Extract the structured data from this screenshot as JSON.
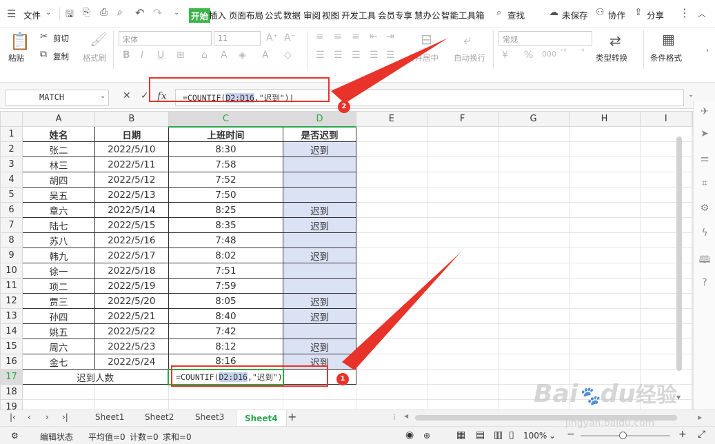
{
  "menubar": {
    "file": "文件",
    "tabs": [
      "开始",
      "插入",
      "页面布局",
      "公式",
      "数据",
      "审阅",
      "视图",
      "开发工具",
      "会员专享",
      "慧办公",
      "智能工具箱"
    ],
    "search": "查找",
    "unsaved": "未保存",
    "collab": "协作",
    "share": "分享"
  },
  "ribbon": {
    "paste": "粘贴",
    "cut": "剪切",
    "copy": "复制",
    "format_painter": "格式刷",
    "font_name": "宋体",
    "font_size": "11",
    "merge_center": "合并居中",
    "wrap": "自动换行",
    "number_format": "常规",
    "type_convert": "类型转换",
    "cond_format": "条件格式"
  },
  "formula_bar": {
    "name_box": "MATCH",
    "fx": "fx",
    "formula_prefix": "=COUNTIF(",
    "formula_ref": "D2:D16",
    "formula_suffix": ",\"迟到\")|"
  },
  "grid": {
    "columns": [
      "A",
      "B",
      "C",
      "D",
      "E",
      "F",
      "G",
      "H",
      "I"
    ],
    "header_row": [
      "姓名",
      "日期",
      "上班时间",
      "是否迟到"
    ],
    "rows": [
      [
        "张二",
        "2022/5/10",
        "8:30",
        "迟到"
      ],
      [
        "林三",
        "2022/5/11",
        "7:58",
        ""
      ],
      [
        "胡四",
        "2022/5/12",
        "7:52",
        ""
      ],
      [
        "吴五",
        "2022/5/13",
        "7:50",
        ""
      ],
      [
        "章六",
        "2022/5/14",
        "8:25",
        "迟到"
      ],
      [
        "陆七",
        "2022/5/15",
        "8:35",
        "迟到"
      ],
      [
        "苏八",
        "2022/5/16",
        "7:48",
        ""
      ],
      [
        "韩九",
        "2022/5/17",
        "8:02",
        "迟到"
      ],
      [
        "徐一",
        "2022/5/18",
        "7:51",
        ""
      ],
      [
        "项二",
        "2022/5/19",
        "7:59",
        ""
      ],
      [
        "贾三",
        "2022/5/20",
        "8:05",
        "迟到"
      ],
      [
        "孙四",
        "2022/5/21",
        "8:40",
        "迟到"
      ],
      [
        "姚五",
        "2022/5/22",
        "7:42",
        ""
      ],
      [
        "周六",
        "2022/5/23",
        "8:12",
        "迟到"
      ],
      [
        "金七",
        "2022/5/24",
        "8:16",
        "迟到"
      ]
    ],
    "row17_label": "迟到人数",
    "row17_formula_prefix": "=COUNTIF(",
    "row17_formula_ref": "D2:D16",
    "row17_formula_suffix": ",\"迟到\")",
    "row_numbers": [
      "1",
      "2",
      "3",
      "4",
      "5",
      "6",
      "7",
      "8",
      "9",
      "10",
      "11",
      "12",
      "13",
      "14",
      "15",
      "16",
      "17",
      "18",
      "19"
    ]
  },
  "annotations": {
    "badge1": "1",
    "badge2": "2",
    "color": "#e8332a"
  },
  "sheet_tabs": [
    "Sheet1",
    "Sheet2",
    "Sheet3",
    "Sheet4"
  ],
  "active_sheet": "Sheet4",
  "statusbar": {
    "mode": "编辑状态",
    "average": "平均值=0",
    "count": "计数=0",
    "sum": "求和=0",
    "zoom": "100%"
  },
  "watermark": {
    "brand": "Bai",
    "brand2": "du",
    "brand3": "经验",
    "url": "jingyan.baidu.com"
  }
}
